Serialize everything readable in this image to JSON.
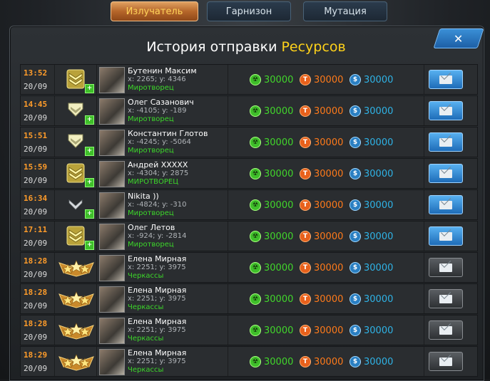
{
  "tabs": [
    {
      "label": "Излучатель",
      "active": true
    },
    {
      "label": "Гарнизон",
      "active": false
    },
    {
      "label": "Мутация",
      "active": false
    }
  ],
  "dialog": {
    "title_part1": "История отправки",
    "title_part2": "Ресурсов",
    "close_label": "✕"
  },
  "icons": {
    "resource1": "radiation-icon",
    "resource2": "titanium-icon",
    "resource3": "credits-icon",
    "action": "mail-icon"
  },
  "colors": {
    "time": "#ff9c2a",
    "city": "#3cd62a",
    "res1": "#41d62b",
    "res2": "#ff7a1a",
    "res3": "#2fb3e6",
    "title_accent": "#ffd21a"
  },
  "rows": [
    {
      "time": "13:52",
      "date": "20/09",
      "rank": "gold-chevron",
      "name": "Бутенин Максим",
      "coords": "x: 2265; y: 4346",
      "city": "Миротворец",
      "r1": "30000",
      "r2": "30000",
      "r3": "30000",
      "mail": "blue"
    },
    {
      "time": "14:45",
      "date": "20/09",
      "rank": "silver-chevron",
      "name": "Олег Сазанович",
      "coords": "x: -4105; y: -189",
      "city": "Миротворец",
      "r1": "30000",
      "r2": "30000",
      "r3": "30000",
      "mail": "blue"
    },
    {
      "time": "15:51",
      "date": "20/09",
      "rank": "silver-chevron",
      "name": "Константин Глотов",
      "coords": "x: -4245; y: -5064",
      "city": "Миротворец",
      "r1": "30000",
      "r2": "30000",
      "r3": "30000",
      "mail": "blue"
    },
    {
      "time": "15:59",
      "date": "20/09",
      "rank": "gold-chevron",
      "name": "Андрей XXXXX",
      "coords": "x: -4304; y: 2875",
      "city": "МИРОТВОРЕЦ",
      "r1": "30000",
      "r2": "30000",
      "r3": "30000",
      "mail": "blue"
    },
    {
      "time": "16:34",
      "date": "20/09",
      "rank": "thin-chevron",
      "name": "Nikita ))",
      "coords": "x: -4824; y: -310",
      "city": "Миротворец",
      "r1": "30000",
      "r2": "30000",
      "r3": "30000",
      "mail": "blue"
    },
    {
      "time": "17:11",
      "date": "20/09",
      "rank": "gold-chevron",
      "name": "Олег Летов",
      "coords": "x: -924; y: -2814",
      "city": "Миротворец",
      "r1": "30000",
      "r2": "30000",
      "r3": "30000",
      "mail": "blue"
    },
    {
      "time": "18:28",
      "date": "20/09",
      "rank": "stars",
      "name": "Елена Мирная",
      "coords": "x: 2251; y: 3975",
      "city": "Черкассы",
      "r1": "30000",
      "r2": "30000",
      "r3": "30000",
      "mail": "grey"
    },
    {
      "time": "18:28",
      "date": "20/09",
      "rank": "stars",
      "name": "Елена Мирная",
      "coords": "x: 2251; y: 3975",
      "city": "Черкассы",
      "r1": "30000",
      "r2": "30000",
      "r3": "30000",
      "mail": "grey"
    },
    {
      "time": "18:28",
      "date": "20/09",
      "rank": "stars",
      "name": "Елена Мирная",
      "coords": "x: 2251; y: 3975",
      "city": "Черкассы",
      "r1": "30000",
      "r2": "30000",
      "r3": "30000",
      "mail": "grey"
    },
    {
      "time": "18:29",
      "date": "20/09",
      "rank": "stars",
      "name": "Елена Мирная",
      "coords": "x: 2251; y: 3975",
      "city": "Черкассы",
      "r1": "30000",
      "r2": "30000",
      "r3": "30000",
      "mail": "grey"
    }
  ]
}
